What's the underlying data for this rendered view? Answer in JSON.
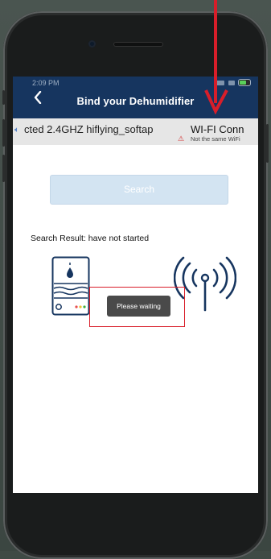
{
  "status": {
    "time": "2:09 PM"
  },
  "navbar": {
    "title": "Bind your Dehumidifier",
    "back_label": "<"
  },
  "info_bar": {
    "ssid_text": "cted 2.4GHZ hiflying_softap",
    "wifi_label": "WI-FI Conn",
    "warning": "Not the same WiFi"
  },
  "search": {
    "button_label": "Search"
  },
  "result": {
    "text": "Search Result: have not started"
  },
  "toast": {
    "text": "Please waiting"
  },
  "colors": {
    "navbar": "#16355f",
    "annotation": "#d81e2a",
    "button": "#d3e4f2"
  },
  "icons": [
    "back-arrow",
    "speaker-icon",
    "warning-icon",
    "dehumidifier-icon",
    "signal-tower-icon"
  ]
}
